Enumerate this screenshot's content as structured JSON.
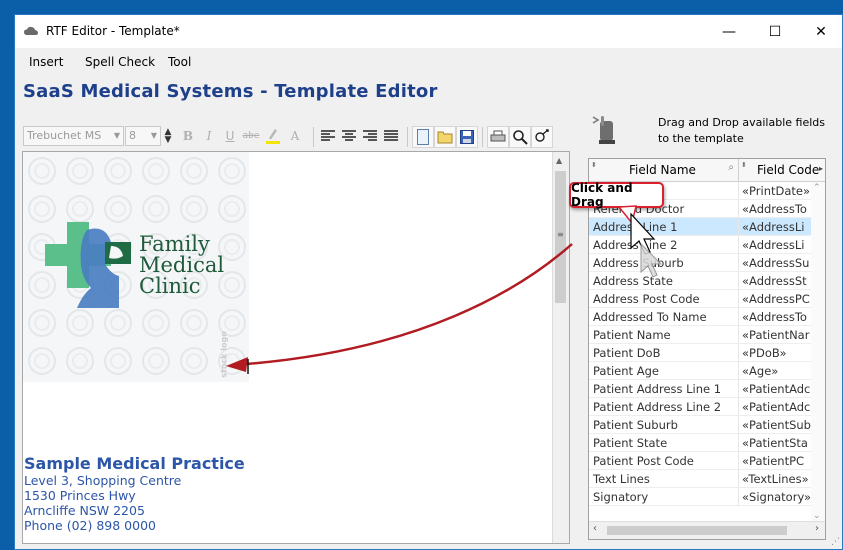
{
  "window": {
    "title": "RTF Editor - Template*",
    "controls": {
      "minimize": "—",
      "maximize": "☐",
      "close": "✕"
    }
  },
  "menu": [
    {
      "label": "Insert"
    },
    {
      "label": "Spell Check"
    },
    {
      "label": "Tool"
    }
  ],
  "heading": "SaaS Medical Systems - Template Editor",
  "toolbar": {
    "font_family": "Trebuchet MS",
    "font_size": "8",
    "bold": "B",
    "italic": "I",
    "underline": "U",
    "strike": "abe",
    "font_button": "A"
  },
  "letterhead": {
    "logo_lines": [
      "Family",
      "Medical",
      "Clinic"
    ],
    "watermark": "stock logo",
    "practice_name": "Sample Medical Practice",
    "address_lines": [
      "Level 3, Shopping Centre",
      "1530 Princes Hwy",
      "Arncliffe NSW 2205",
      "Phone (02) 898 0000"
    ]
  },
  "right_panel": {
    "hint": "Drag and Drop available fields to the template",
    "columns": [
      "Field Name",
      "Field Code"
    ],
    "callout": "Click and Drag",
    "rows": [
      {
        "name": "",
        "code": "«PrintDate»"
      },
      {
        "name": "Referred Doctor",
        "code": "«AddressTo"
      },
      {
        "name": "Address Line 1",
        "code": "«AddressLi",
        "selected": true
      },
      {
        "name": "Address Line 2",
        "code": "«AddressLi"
      },
      {
        "name": "Address Suburb",
        "code": "«AddressSu"
      },
      {
        "name": "Address State",
        "code": "«AddressSt"
      },
      {
        "name": "Address Post Code",
        "code": "«AddressPC"
      },
      {
        "name": "Addressed To Name",
        "code": "«AddressTo"
      },
      {
        "name": "Patient Name",
        "code": "«PatientNar"
      },
      {
        "name": "Patient DoB",
        "code": "«PDoB»"
      },
      {
        "name": "Patient Age",
        "code": "«Age»"
      },
      {
        "name": "Patient Address Line 1",
        "code": "«PatientAdc"
      },
      {
        "name": "Patient Address Line 2",
        "code": "«PatientAdc"
      },
      {
        "name": "Patient Suburb",
        "code": "«PatientSub"
      },
      {
        "name": "Patient State",
        "code": "«PatientSta"
      },
      {
        "name": "Patient Post Code",
        "code": "«PatientPC"
      },
      {
        "name": "Text Lines",
        "code": "«TextLines»"
      },
      {
        "name": "Signatory",
        "code": "«Signatory»"
      }
    ]
  },
  "colors": {
    "heading": "#1e3f8a",
    "practice_text": "#2c56a8",
    "logo_green": "#5bbf8c",
    "logo_blue": "#4a7fc1",
    "arrow_red": "#b01c22",
    "selection": "#cce8ff"
  }
}
